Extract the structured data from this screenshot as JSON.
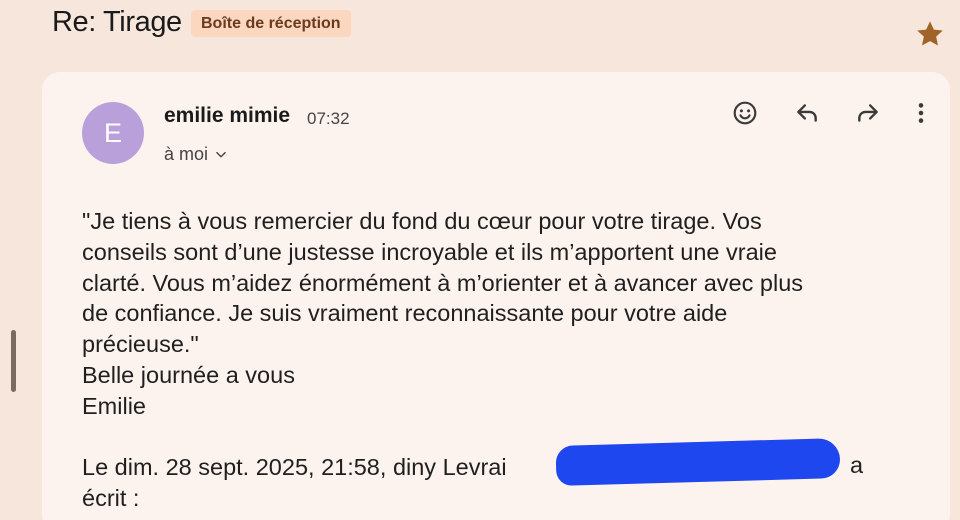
{
  "header": {
    "subject": "Re: Tirage",
    "label_chip": "Boîte de réception",
    "star_icon": "star-icon",
    "star_color": "#a06328"
  },
  "message": {
    "avatar_letter": "E",
    "avatar_color": "#b9a0db",
    "sender_name": "emilie mimie",
    "time": "07:32",
    "recipient": "à moi",
    "actions": [
      {
        "icon": "emoji-react-icon"
      },
      {
        "icon": "reply-icon"
      },
      {
        "icon": "forward-icon"
      },
      {
        "icon": "more-vert-icon"
      }
    ],
    "body_lines": [
      "\"Je tiens à vous remercier du fond du cœur pour votre tirage. Vos",
      "conseils sont d’une justesse incroyable et ils m’apportent une vraie",
      "clarté. Vous m’aidez énormément à m’orienter et à avancer avec plus",
      "de confiance. Je suis vraiment reconnaissante pour votre aide",
      "précieuse.\"",
      "Belle journée a vous",
      "Emilie"
    ],
    "quote_intro": "Le dim. 28 sept. 2025, 21:58, diny Levrai",
    "quote_after_redaction": "a",
    "quote_second_line": "écrit :",
    "redaction_color": "#1f47f0"
  }
}
